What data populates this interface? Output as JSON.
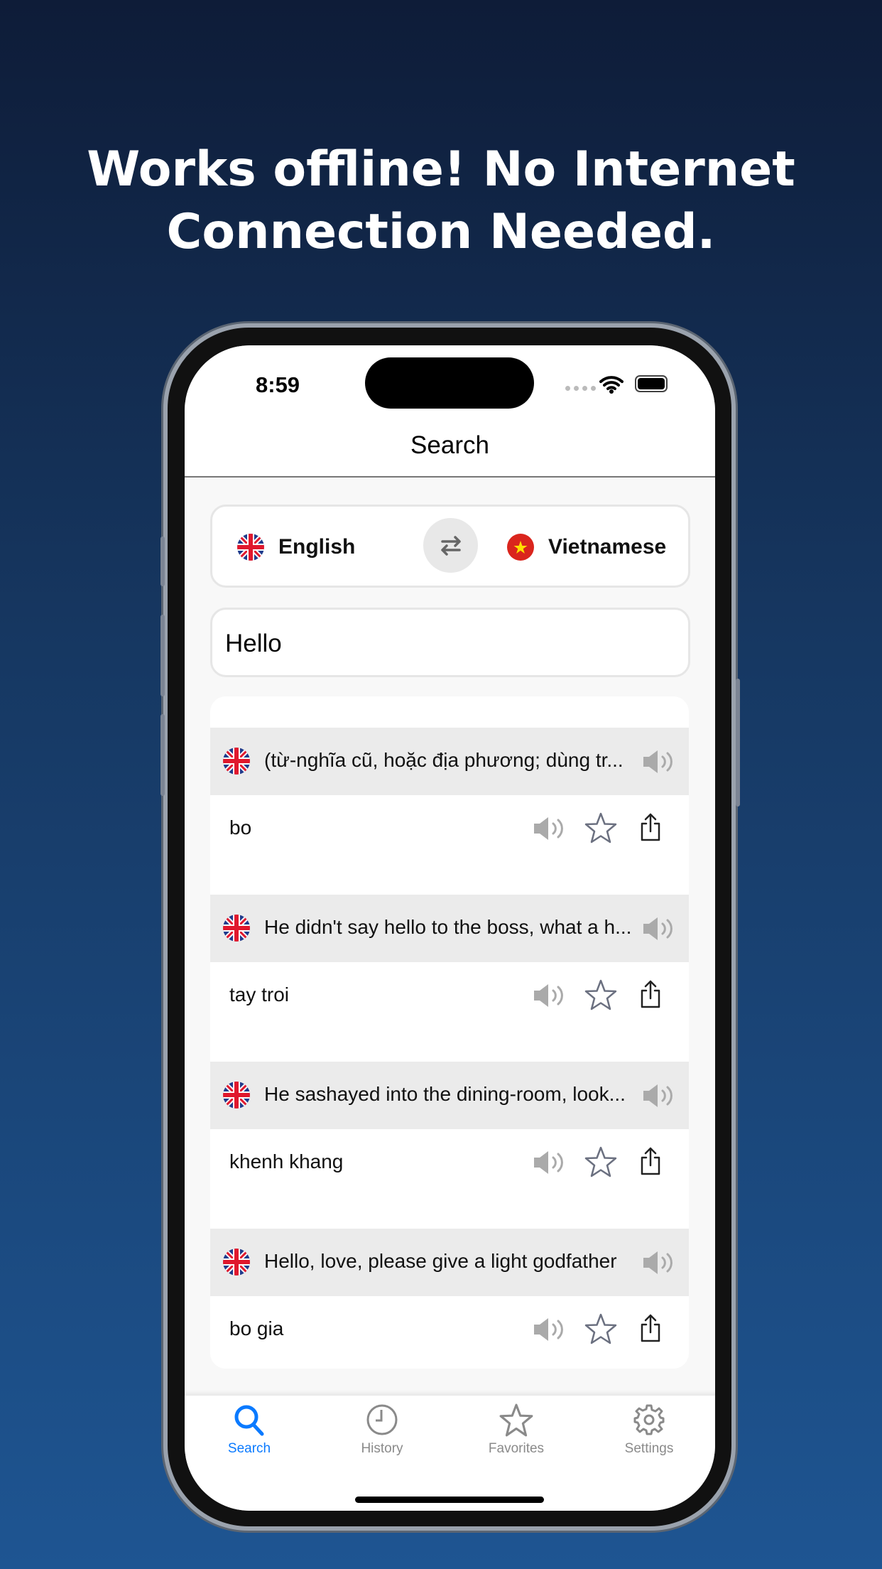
{
  "headline": {
    "line1": "Works offline! No Internet",
    "line2": "Connection Needed."
  },
  "status": {
    "time": "8:59"
  },
  "nav": {
    "title": "Search"
  },
  "languages": {
    "source": "English",
    "target": "Vietnamese",
    "swap_icon": "swap-arrows-icon"
  },
  "search": {
    "value": "Hello"
  },
  "results": [
    {
      "source": "(từ-nghĩa cũ, hoặc địa phương; dùng tr...",
      "translation": "bo"
    },
    {
      "source": "He didn't say hello to the boss, what a h...",
      "translation": "tay troi"
    },
    {
      "source": "He sashayed into the dining-room, look...",
      "translation": "khenh khang"
    },
    {
      "source": "Hello, love, please give a light godfather",
      "translation": "bo gia"
    }
  ],
  "tabs": [
    {
      "label": "Search",
      "icon": "search-icon",
      "active": true
    },
    {
      "label": "History",
      "icon": "clock-icon"
    },
    {
      "label": "Favorites",
      "icon": "star-icon"
    },
    {
      "label": "Settings",
      "icon": "gear-icon"
    }
  ],
  "colors": {
    "accent": "#0a7aff",
    "inactive": "#8a8a8a"
  }
}
